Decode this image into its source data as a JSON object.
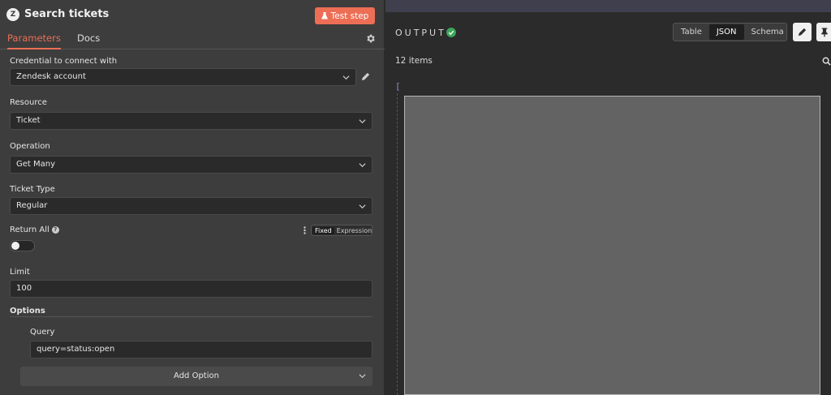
{
  "header": {
    "title": "Search tickets",
    "logo": "Z",
    "test_button": "Test step"
  },
  "tabs": [
    {
      "label": "Parameters",
      "active": true
    },
    {
      "label": "Docs",
      "active": false
    }
  ],
  "form": {
    "credential_label": "Credential to connect with",
    "credential_value": "Zendesk account",
    "resource_label": "Resource",
    "resource_value": "Ticket",
    "operation_label": "Operation",
    "operation_value": "Get Many",
    "ticket_type_label": "Ticket Type",
    "ticket_type_value": "Regular",
    "return_all_label": "Return All",
    "help_glyph": "?",
    "mode_fixed": "Fixed",
    "mode_expression": "Expression",
    "return_all_on": false,
    "limit_label": "Limit",
    "limit_value": "100",
    "options_label": "Options",
    "query_label": "Query",
    "query_value": "query=status:open",
    "add_option": "Add Option"
  },
  "output": {
    "title": "OUTPUT",
    "views": [
      "Table",
      "JSON",
      "Schema"
    ],
    "active_view": "JSON",
    "item_count": "12 items",
    "json_open": "["
  },
  "colors": {
    "accent": "#ec6e55",
    "success": "#3ea55c",
    "panel": "#3d3d3d",
    "background": "#2b2b2b"
  },
  "icons": [
    "zendesk-logo-icon",
    "flask-icon",
    "gear-icon",
    "pencil-icon",
    "chevron-down-icon",
    "help-icon",
    "kebab-icon",
    "check-circle-icon",
    "edit-icon",
    "pin-icon",
    "search-icon"
  ]
}
